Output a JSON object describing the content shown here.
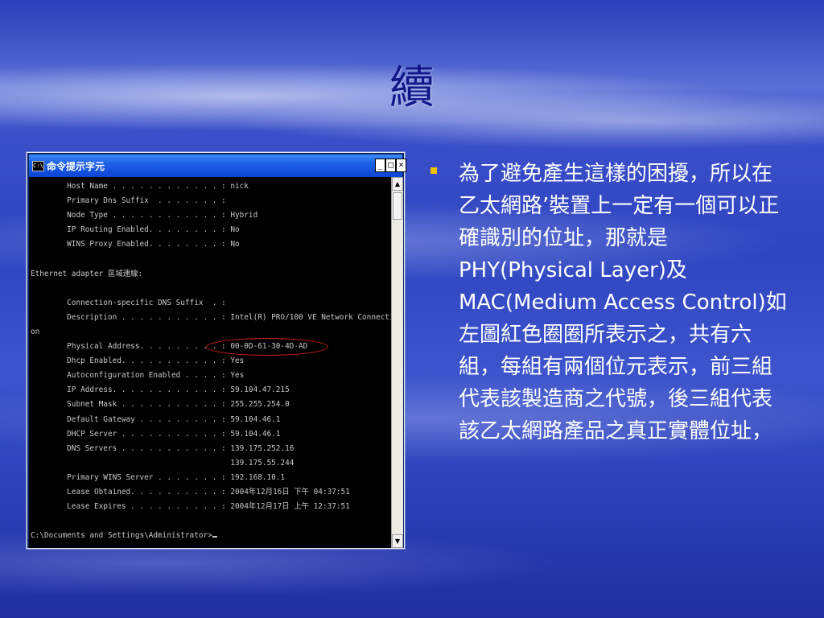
{
  "slide": {
    "title": "續",
    "bullet": "為了避免產生這樣的困擾，所以在乙太網路’裝置上一定有一個可以正確識別的位址，那就是PHY(Physical Layer)及MAC(Medium Access Control)如左圖紅色圈圈所表示之，共有六組，每組有兩個位元表示，前三組代表該製造商之代號，後三組代表該乙太網路產品之真正實體位址，"
  },
  "window": {
    "icon_text": "C:\\",
    "title": "命令提示字元",
    "minimize": "_",
    "maximize": "□",
    "close": "×"
  },
  "console": {
    "lines": [
      "        Host Name . . . . . . . . . . . . : nick",
      "        Primary Dns Suffix  . . . . . . . :",
      "        Node Type . . . . . . . . . . . . : Hybrid",
      "        IP Routing Enabled. . . . . . . . : No",
      "        WINS Proxy Enabled. . . . . . . . : No",
      "",
      "Ethernet adapter 區域連線:",
      "",
      "        Connection-specific DNS Suffix  . :",
      "        Description . . . . . . . . . . . : Intel(R) PRO/100 VE Network Connecti",
      "on",
      "        Physical Address. . . . . . . . . : 00-0D-61-30-4D-AD",
      "        Dhcp Enabled. . . . . . . . . . . : Yes",
      "        Autoconfiguration Enabled . . . . : Yes",
      "        IP Address. . . . . . . . . . . . : 59.104.47.215",
      "        Subnet Mask . . . . . . . . . . . : 255.255.254.0",
      "        Default Gateway . . . . . . . . . : 59.104.46.1",
      "        DHCP Server . . . . . . . . . . . : 59.104.46.1",
      "        DNS Servers . . . . . . . . . . . : 139.175.252.16",
      "                                            139.175.55.244",
      "        Primary WINS Server . . . . . . . : 192.168.10.1",
      "        Lease Obtained. . . . . . . . . . : 2004年12月16日 下午 04:37:51",
      "        Lease Expires . . . . . . . . . . : 2004年12月17日 上午 12:37:51",
      "",
      "C:\\Documents and Settings\\Administrator>"
    ]
  },
  "scrollbar": {
    "up": "▲",
    "down": "▼"
  },
  "colors": {
    "highlight": "#e02020",
    "bullet": "#f2c200",
    "title": "#12188a"
  }
}
